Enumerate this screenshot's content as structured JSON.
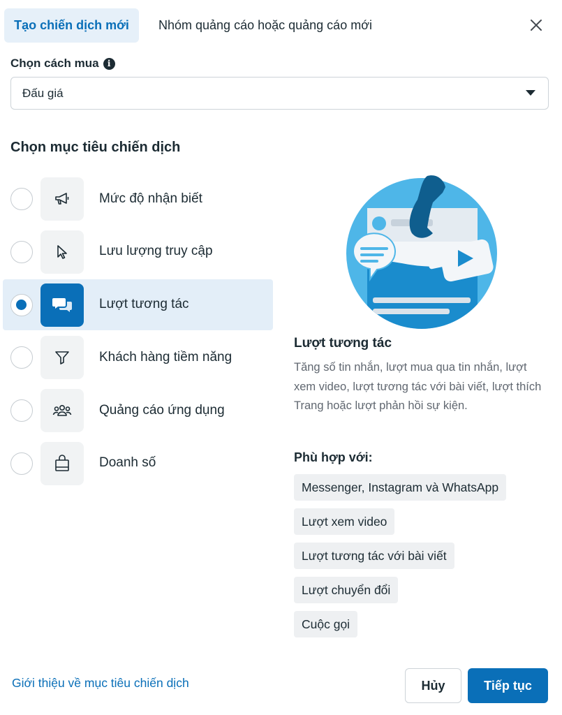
{
  "header": {
    "tab_active": "Tạo chiến dịch mới",
    "tab_other": "Nhóm quảng cáo hoặc quảng cáo mới",
    "close_icon": "close-icon"
  },
  "buying": {
    "label": "Chọn cách mua",
    "info_icon": "info-icon",
    "selected": "Đấu giá"
  },
  "objectives": {
    "heading": "Chọn mục tiêu chiến dịch",
    "items": [
      {
        "label": "Mức độ nhận biết",
        "icon": "megaphone-icon",
        "selected": false
      },
      {
        "label": "Lưu lượng truy cập",
        "icon": "cursor-icon",
        "selected": false
      },
      {
        "label": "Lượt tương tác",
        "icon": "chat-bubbles-icon",
        "selected": true
      },
      {
        "label": "Khách hàng tiềm năng",
        "icon": "filter-icon",
        "selected": false
      },
      {
        "label": "Quảng cáo ứng dụng",
        "icon": "people-icon",
        "selected": false
      },
      {
        "label": "Doanh số",
        "icon": "shopping-bag-icon",
        "selected": false
      }
    ]
  },
  "detail": {
    "title": "Lượt tương tác",
    "description": "Tăng số tin nhắn, lượt mua qua tin nhắn, lượt xem video, lượt tương tác với bài viết, lượt thích Trang hoặc lượt phản hồi sự kiện.",
    "fit_label": "Phù hợp với:",
    "chips": [
      "Messenger, Instagram và WhatsApp",
      "Lượt xem video",
      "Lượt tương tác với bài viết",
      "Lượt chuyển đổi",
      "Cuộc gọi"
    ]
  },
  "footer": {
    "learn_link": "Giới thiệu về mục tiêu chiến dịch",
    "cancel": "Hủy",
    "continue": "Tiếp tục"
  },
  "colors": {
    "accent": "#0a6fb8",
    "selected_bg": "#e3eef8",
    "text": "#1c2b33",
    "muted": "#606770"
  }
}
